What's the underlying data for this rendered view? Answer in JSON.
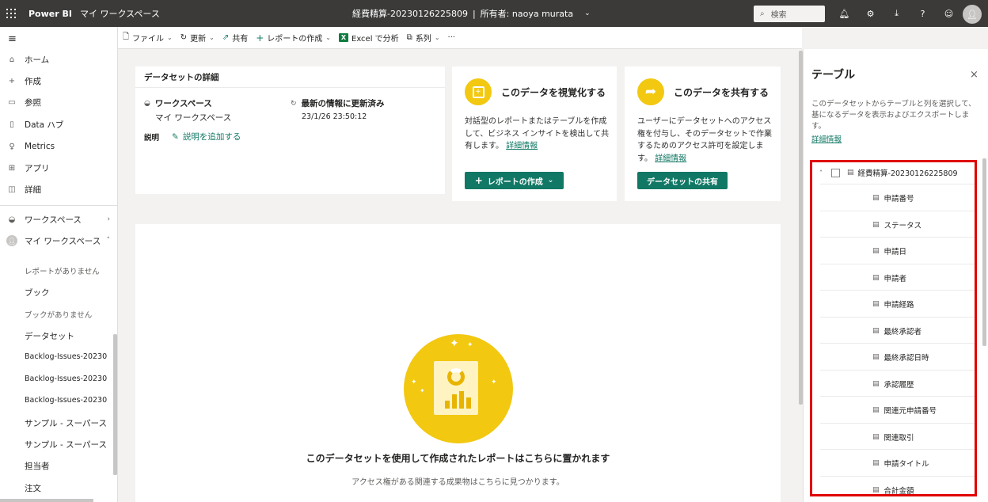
{
  "topbar": {
    "brand": "Power BI",
    "workspace": "マイ ワークスペース",
    "dataset_title": "経費精算-20230126225809",
    "separator": "|",
    "owner": "所有者: naoya murata",
    "search_placeholder": "検索"
  },
  "nav": {
    "items": [
      {
        "label": "ホーム",
        "icon": "home-icon"
      },
      {
        "label": "作成",
        "icon": "plus-icon"
      },
      {
        "label": "参照",
        "icon": "folder-icon"
      },
      {
        "label": "Data ハブ",
        "icon": "data-hub-icon"
      },
      {
        "label": "Metrics",
        "icon": "trophy-icon"
      },
      {
        "label": "アプリ",
        "icon": "apps-icon"
      },
      {
        "label": "詳細",
        "icon": "book-icon"
      }
    ],
    "workspaces": "ワークスペース",
    "my_workspace": "マイ ワークスペース",
    "sub": [
      "レポートがありません",
      "ブック",
      "ブックがありません",
      "データセット",
      "Backlog-Issues-20230",
      "Backlog-Issues-20230",
      "Backlog-Issues-20230",
      "サンプル - スーパース",
      "サンプル - スーパース",
      "担当者",
      "注文"
    ]
  },
  "commandbar": {
    "file": "ファイル",
    "refresh": "更新",
    "share": "共有",
    "create_report": "レポートの作成",
    "analyze_excel": "Excel で分析",
    "lineage": "系列",
    "more": "···"
  },
  "details": {
    "header": "データセットの詳細",
    "workspace_label": "ワークスペース",
    "workspace_value": "マイ ワークスペース",
    "refresh_label": "最新の情報に更新済み",
    "refresh_value": "23/1/26 23:50:12",
    "description_label": "説明",
    "add_description": "説明を追加する"
  },
  "visualize": {
    "title": "このデータを視覚化する",
    "desc_lines": [
      "対話型のレポートまたはテーブルを作成",
      "して、ビジネス インサイトを検出して共",
      "有します。"
    ],
    "link": "詳細情報",
    "button": "レポートの作成"
  },
  "share_card": {
    "title": "このデータを共有する",
    "desc_lines": [
      "ユーザーにデータセットへのアクセス",
      "権を付与し、そのデータセットで作業",
      "するためのアクセス許可を設定しま",
      "す。"
    ],
    "link": "詳細情報",
    "button": "データセットの共有"
  },
  "empty_state": {
    "title": "このデータセットを使用して作成されたレポートはこちらに置かれます",
    "subtitle": "アクセス権がある関連する成果物はこちらに見つかります。"
  },
  "table_pane": {
    "title": "テーブル",
    "close": "×",
    "description": "このデータセットからテーブルと列を選択して、基になるデータを表示およびエクスポートします。",
    "link": "詳細情報",
    "table_name": "経費精算-20230126225809",
    "fields": [
      "申請番号",
      "ステータス",
      "申請日",
      "申請者",
      "申請経路",
      "最終承認者",
      "最終承認日時",
      "承認履歴",
      "関連元申請番号",
      "関連取引",
      "申請タイトル",
      "合計金額"
    ]
  },
  "colors": {
    "topbar": "#3b3a39",
    "accent_green": "#117865",
    "brand_yellow": "#f2c811",
    "highlight_red": "#e00000"
  }
}
